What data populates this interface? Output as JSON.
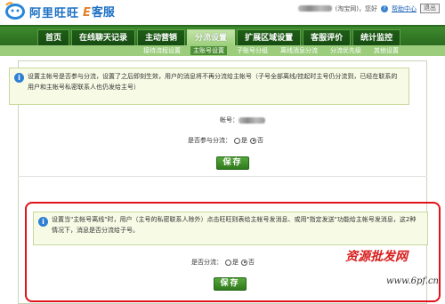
{
  "header": {
    "brand": "阿里旺旺",
    "brand_sub_letter": "E",
    "brand_sub": "客服",
    "user_suffix": "(淘宝网)，您好",
    "help_link": "帮助中心",
    "exit_label": "退出"
  },
  "nav": {
    "tabs": [
      "首页",
      "在线聊天记录",
      "主动营销",
      "分流设置",
      "扩展区域设置",
      "客服评价",
      "统计监控"
    ],
    "active_tab": "分流设置",
    "subtabs": [
      "接待流程设置",
      "主账号设置",
      "子账号分组",
      "离线消息分流",
      "分流优先级",
      "其他设置"
    ],
    "active_subtab": "主账号设置"
  },
  "section1": {
    "notice": "设置主帐号是否参与分流，设置了之后即刻生效，用户的消息将不再分流给主帐号（子号全部离线/挂起时主号仍分流到，已经在联系的用户和主帐号私密联系人也仍发给主号）",
    "account_label": "帐号：",
    "participate_label": "是否参与分流：",
    "yes": "是",
    "no": "否",
    "participate_value": "否",
    "save": "保存"
  },
  "section2": {
    "notice": "设置当\"主帐号离线\"时，用户（主号的私密联系人除外）点击旺旺则表给主帐号发消息、或用\"指定发送\"功能给主帐号发消息，这2种情况下，消息是否分流给子号。",
    "split_label": "是否分流：",
    "yes": "是",
    "no": "否",
    "split_value": "否",
    "save": "保存"
  },
  "watermark": {
    "title": "资源批发网",
    "url": "www.6pf.cn"
  },
  "colors": {
    "nav_green": "#2b6c1f",
    "subnav_green": "#9bcd7d",
    "highlight_red": "#e0121b",
    "brand_blue": "#1a6fc4"
  }
}
